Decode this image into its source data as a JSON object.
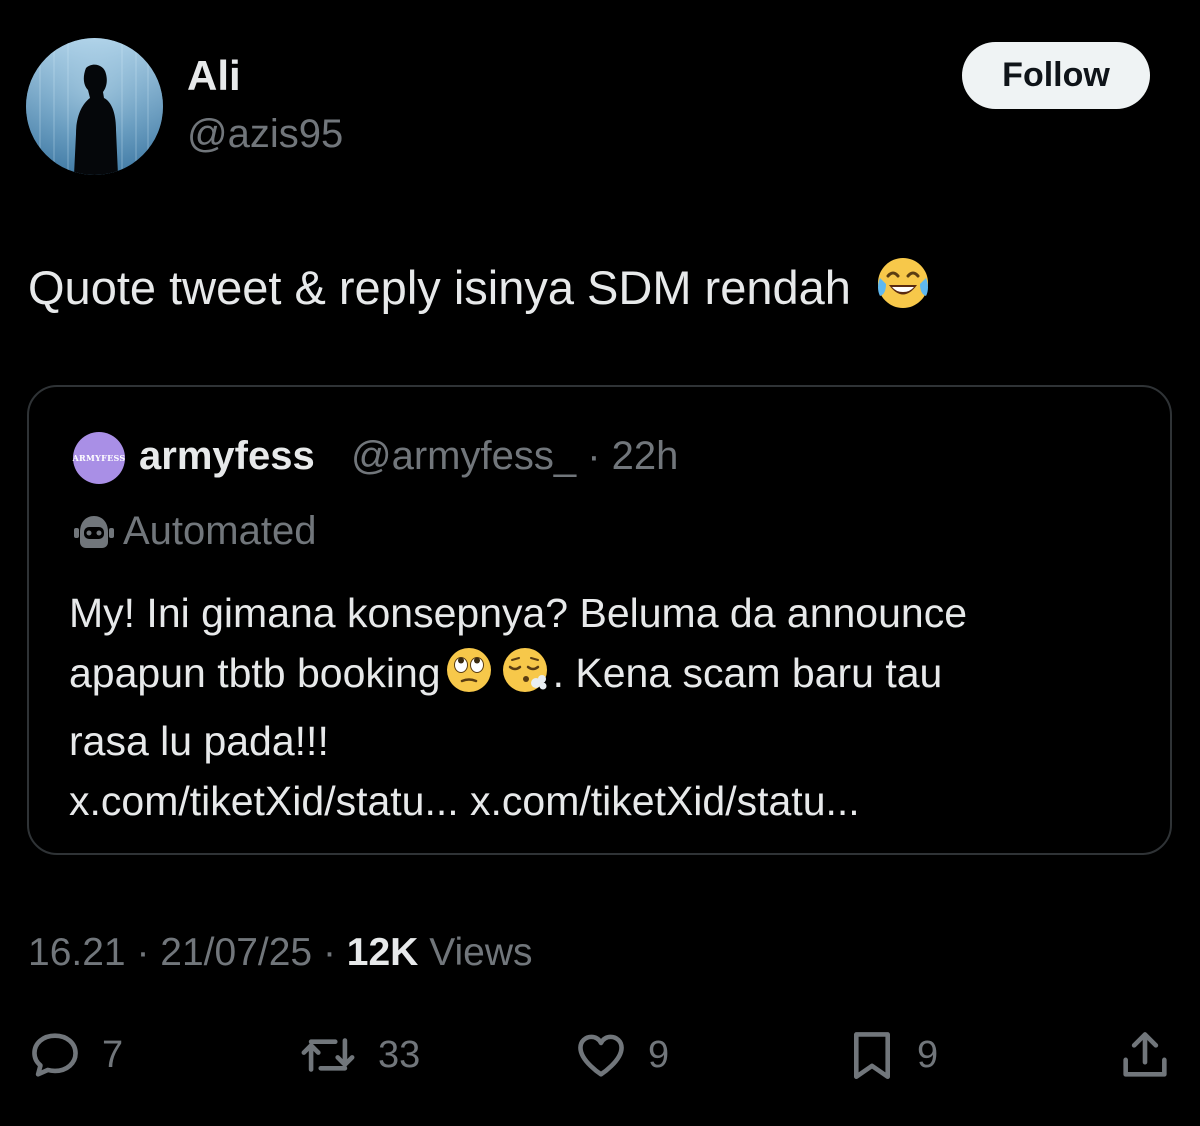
{
  "author": {
    "display_name": "Ali",
    "handle": "@azis95",
    "follow_label": "Follow"
  },
  "tweet": {
    "text": "Quote tweet & reply isinya SDM rendah",
    "emoji": "face-with-tears-of-joy"
  },
  "quoted": {
    "avatar_text": "ARMYFESS",
    "name": "armyfess",
    "handle": "@armyfess_",
    "time": "· 22h",
    "automated_label": "Automated",
    "lines": [
      "My! Ini gimana konsepnya? Beluma da announce",
      "apapun tbtb booking",
      ". Kena scam baru tau",
      "rasa lu pada!!!",
      "x.com/tiketXid/statu... x.com/tiketXid/statu..."
    ],
    "emojis": [
      "face-with-rolling-eyes",
      "face-exhaling"
    ]
  },
  "meta": {
    "time": "16.21",
    "date": "21/07/25",
    "separator": "·",
    "views_count": "12K",
    "views_label": "Views"
  },
  "actions": {
    "replies": "7",
    "reposts": "33",
    "likes": "9",
    "bookmarks": "9"
  },
  "colors": {
    "background": "#000000",
    "text": "#e7e9ea",
    "muted": "#71767b",
    "border": "#2f3336",
    "follow_bg": "#eff3f4",
    "quote_avatar": "#a98fe6"
  }
}
